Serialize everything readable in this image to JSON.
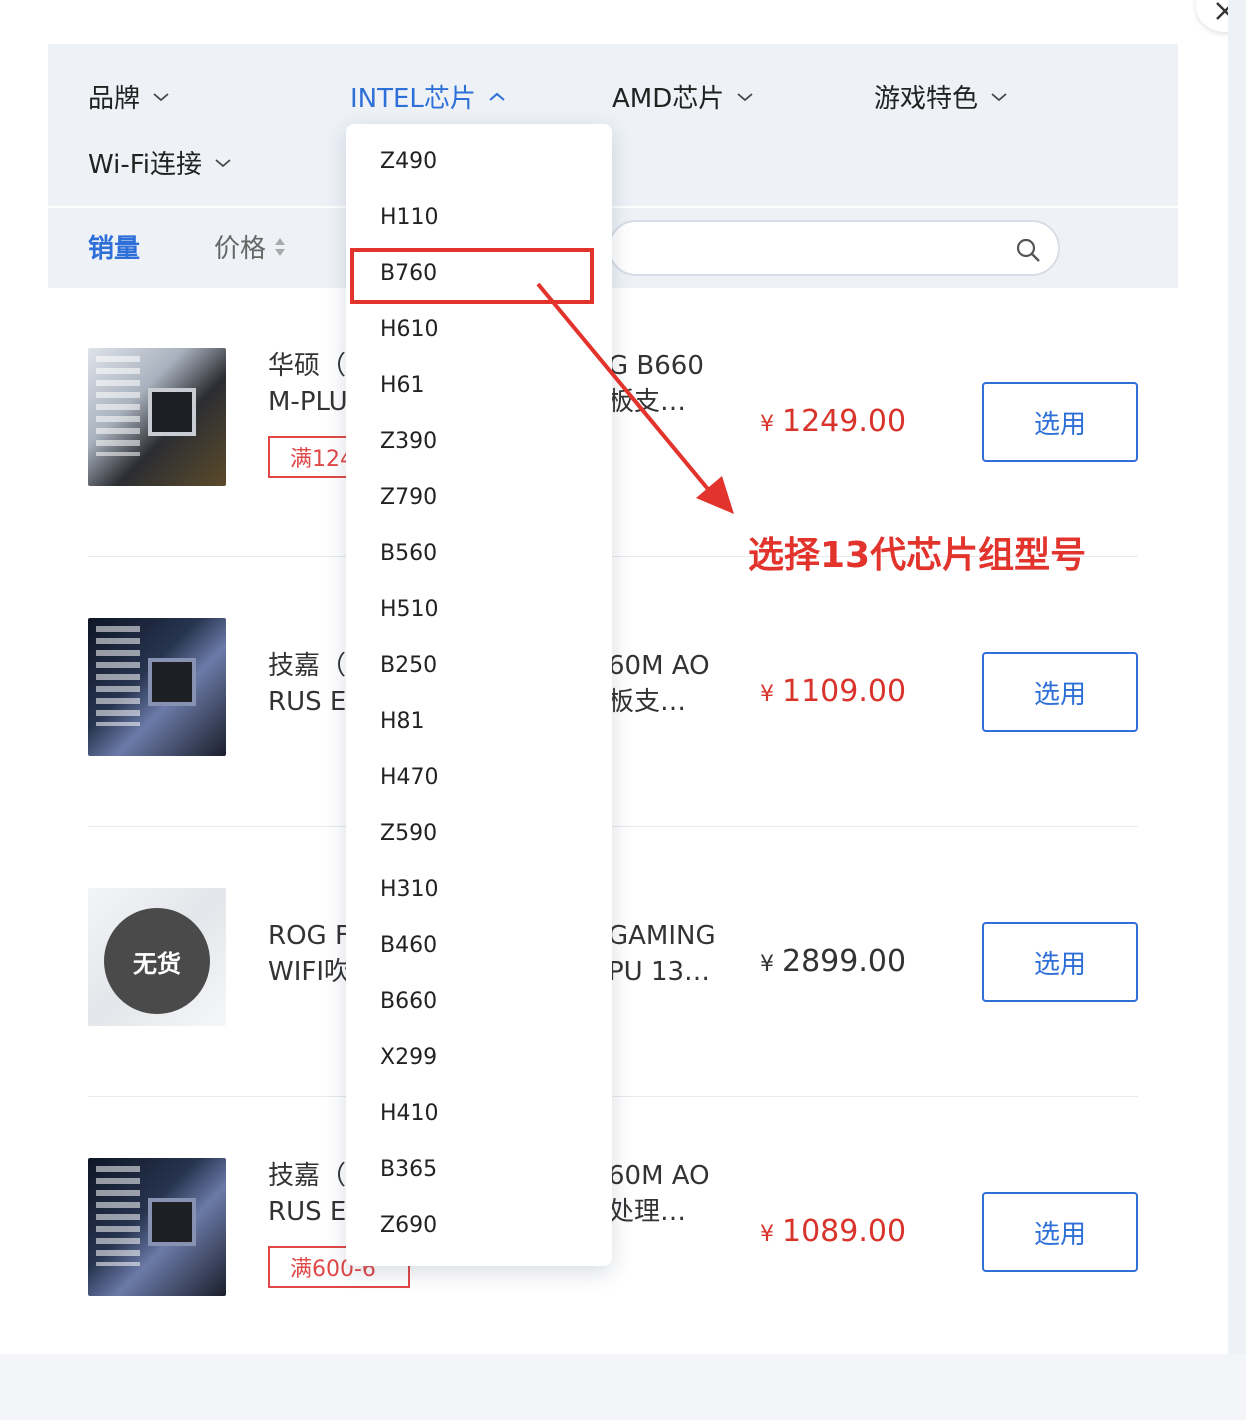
{
  "filters": [
    {
      "label": "品牌",
      "state": "collapsed"
    },
    {
      "label": "INTEL芯片",
      "state": "expanded"
    },
    {
      "label": "AMD芯片",
      "state": "collapsed"
    },
    {
      "label": "游戏特色",
      "state": "collapsed"
    },
    {
      "label": "Wi-Fi连接",
      "state": "collapsed"
    }
  ],
  "sort": {
    "sales": "销量",
    "price": "价格"
  },
  "search": {
    "placeholder": ""
  },
  "dropdown": {
    "items": [
      "Z490",
      "H110",
      "B760",
      "H610",
      "H61",
      "Z390",
      "Z790",
      "B560",
      "H510",
      "B250",
      "H81",
      "H470",
      "Z590",
      "H310",
      "B460",
      "B660",
      "X299",
      "H410",
      "B365",
      "Z690"
    ],
    "highlighted": "B760"
  },
  "products": [
    {
      "title_left_1": "华硕（",
      "title_left_2": "M-PLU",
      "title_right_1": "G B660",
      "title_right_2": "板支…",
      "coupon": "满124",
      "price": "1249.00",
      "out_of_stock": false,
      "button": "选用"
    },
    {
      "title_left_1": "技嘉（",
      "title_left_2": "RUS E",
      "title_right_1": "60M AO",
      "title_right_2": "板支…",
      "coupon": "",
      "price": "1109.00",
      "out_of_stock": false,
      "button": "选用"
    },
    {
      "title_left_1": "ROG F",
      "title_left_2": "WIFI吹",
      "title_right_1": "GAMING",
      "title_right_2": "PU 13…",
      "coupon": "",
      "price": "2899.00",
      "out_of_stock": true,
      "out_of_stock_label": "无货",
      "button": "选用"
    },
    {
      "title_left_1": "技嘉（",
      "title_left_2": "RUS E",
      "title_right_1": "60M AO",
      "title_right_2": "处理…",
      "coupon": "满600-6",
      "price": "1089.00",
      "out_of_stock": false,
      "button": "选用"
    }
  ],
  "currency": "¥",
  "annotation": "选择13代芯片组型号",
  "colors": {
    "accent": "#2f6fd8",
    "price": "#d9342b",
    "annotation": "#e2332c"
  },
  "icons": {
    "filter_collapsed": "chevron-down-icon",
    "filter_expanded": "chevron-up-icon",
    "sort_price": "sort-arrows-icon",
    "search": "search-icon",
    "close": "close-icon"
  }
}
